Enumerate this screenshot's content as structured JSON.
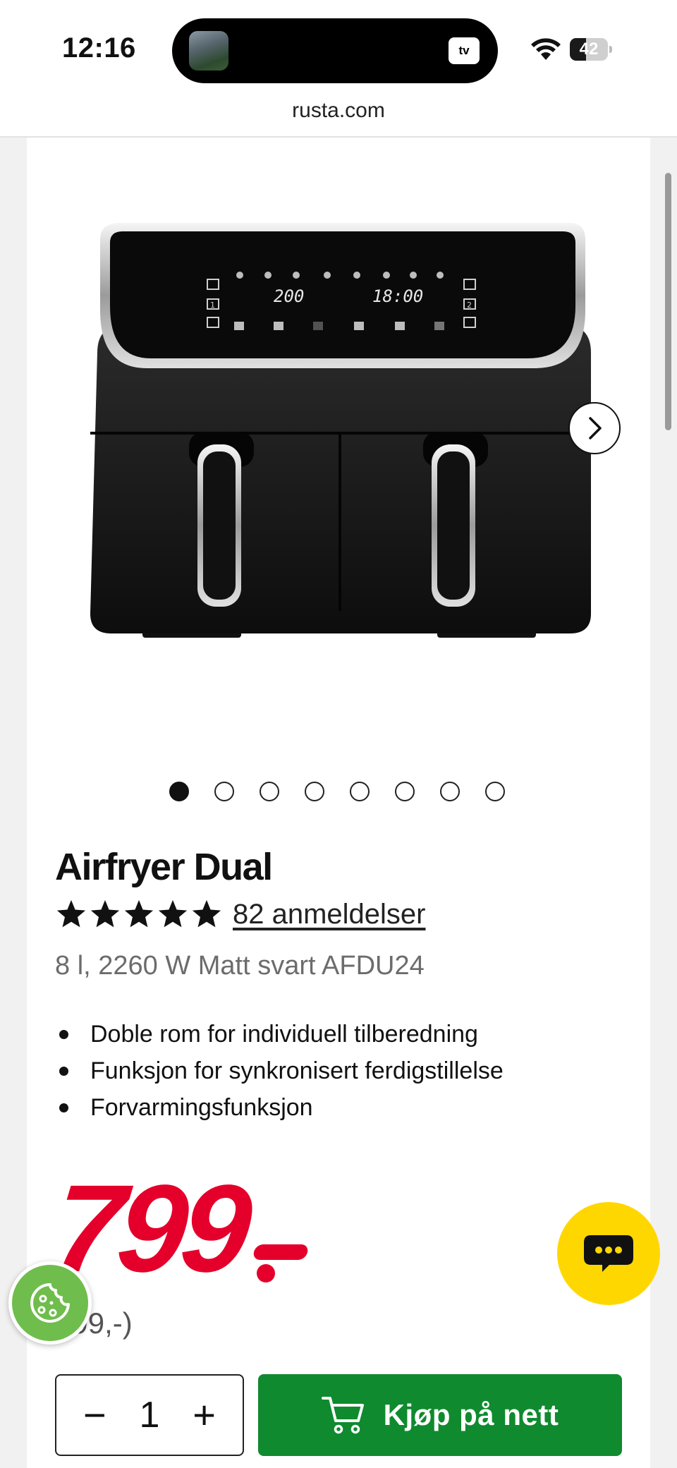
{
  "status_bar": {
    "time": "12:16",
    "battery_level": "42",
    "battery_fraction": 0.42,
    "island_app_label": "tv"
  },
  "browser": {
    "url": "rusta.com"
  },
  "product": {
    "title": "Airfryer Dual",
    "rating": 5,
    "reviews_label": "82 anmeldelser",
    "subtitle": "8 l, 2260 W Matt svart AFDU24",
    "features": [
      "Doble rom for individuell tilberedning",
      "Funksjon for synkronisert ferdigstillelse",
      "Forvarmingsfunksjon"
    ],
    "display_temp": "200",
    "display_time": "18:00",
    "display_zone_left": "1",
    "display_zone_right": "2"
  },
  "carousel": {
    "total": 8,
    "active_index": 0
  },
  "price": {
    "current": "799",
    "previous_partial": "099,-)"
  },
  "cart": {
    "quantity": "1",
    "minus_label": "−",
    "plus_label": "+",
    "buy_label": "Kjøp på nett"
  },
  "colors": {
    "price_red": "#e4002b",
    "buy_green": "#0f8a2e",
    "chat_yellow": "#ffd700",
    "cookie_green": "#6fbd4c"
  },
  "icons": {
    "wifi": "wifi-icon",
    "battery": "battery-icon",
    "next": "chevron-right-icon",
    "star": "star-icon",
    "cookie": "cookie-icon",
    "chat": "chat-icon",
    "cart": "cart-icon"
  }
}
